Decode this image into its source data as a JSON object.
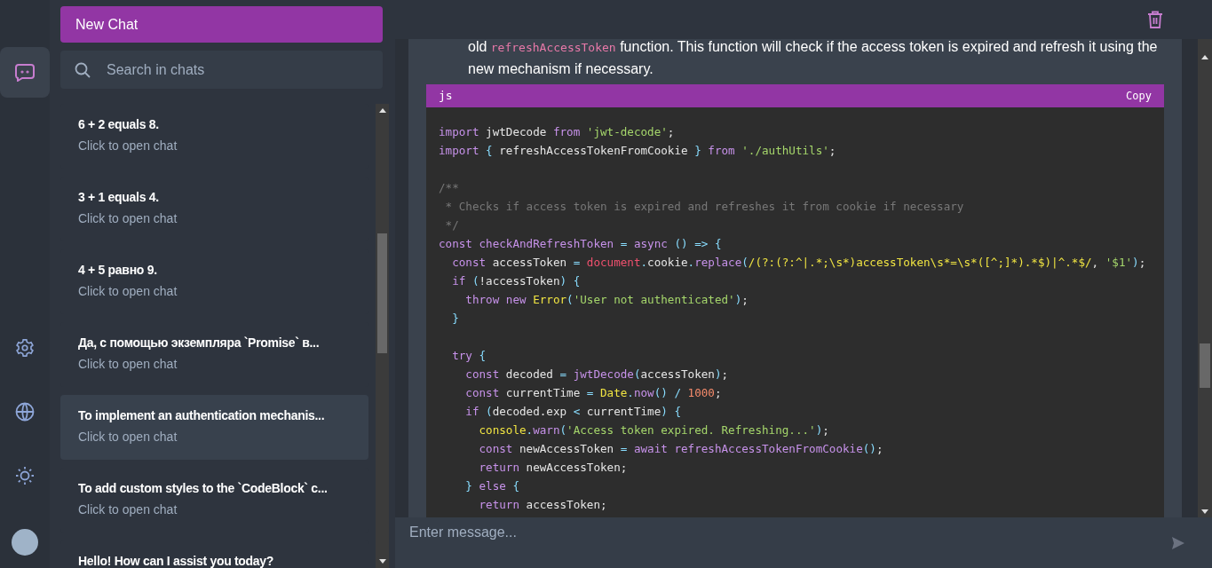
{
  "rail": {
    "items": [
      {
        "kind": "chat",
        "selected": true
      },
      {
        "kind": "settings",
        "selected": false
      },
      {
        "kind": "globe",
        "selected": false
      },
      {
        "kind": "theme",
        "selected": false
      }
    ]
  },
  "sidebar": {
    "new_chat": "New Chat",
    "search": {
      "placeholder": "Search in chats"
    },
    "chats": [
      {
        "title": "6 + 2 equals 8.",
        "subtitle": "Click to open chat",
        "selected": false
      },
      {
        "title": "3 + 1 equals 4.",
        "subtitle": "Click to open chat",
        "selected": false
      },
      {
        "title": "4 + 5 равно 9.",
        "subtitle": "Click to open chat",
        "selected": false
      },
      {
        "title": "Да, с помощью экземпляра `Promise` в...",
        "subtitle": "Click to open chat",
        "selected": false
      },
      {
        "title": "To implement an authentication mechanis...",
        "subtitle": "Click to open chat",
        "selected": true
      },
      {
        "title": "To add custom styles to the `CodeBlock` c...",
        "subtitle": "Click to open chat",
        "selected": false
      },
      {
        "title": "Hello! How can I assist you today?",
        "selected": false
      }
    ]
  },
  "message": {
    "paragraph": [
      {
        "kind": "text",
        "text": "old "
      },
      {
        "kind": "code",
        "text": "refreshAccessToken"
      },
      {
        "kind": "text",
        "text": " function. This function will check if the access token is expired and refresh it using the new mechanism if necessary."
      }
    ],
    "code_block": {
      "language": "js",
      "copy": "Copy",
      "lines": [
        [
          {
            "kind": "kw",
            "text": "import"
          },
          {
            "kind": "id",
            "text": " jwtDecode "
          },
          {
            "kind": "kw",
            "text": "from"
          },
          {
            "kind": "str",
            "text": " 'jwt-decode'"
          },
          {
            "kind": "id",
            "text": ";"
          }
        ],
        [
          {
            "kind": "kw",
            "text": "import"
          },
          {
            "kind": "punc",
            "text": " { "
          },
          {
            "kind": "id",
            "text": "refreshAccessTokenFromCookie"
          },
          {
            "kind": "punc",
            "text": " } "
          },
          {
            "kind": "kw",
            "text": "from"
          },
          {
            "kind": "str",
            "text": " './authUtils'"
          },
          {
            "kind": "id",
            "text": ";"
          }
        ],
        {
          "kind": "blank"
        },
        [
          {
            "kind": "com",
            "text": "/**"
          }
        ],
        [
          {
            "kind": "com",
            "text": " * Checks if access token is expired and refreshes it from cookie if necessary"
          }
        ],
        [
          {
            "kind": "com",
            "text": " */"
          }
        ],
        [
          {
            "kind": "kw",
            "text": "const"
          },
          {
            "kind": "fn",
            "text": " checkAndRefreshToken"
          },
          {
            "kind": "punc",
            "text": " = "
          },
          {
            "kind": "kw",
            "text": "async"
          },
          {
            "kind": "punc",
            "text": " () => {"
          }
        ],
        [
          {
            "kind": "kw",
            "text": "  const"
          },
          {
            "kind": "id",
            "text": " accessToken "
          },
          {
            "kind": "punc",
            "text": "= "
          },
          {
            "kind": "glob",
            "text": "document"
          },
          {
            "kind": "punc",
            "text": "."
          },
          {
            "kind": "id",
            "text": "cookie"
          },
          {
            "kind": "punc",
            "text": "."
          },
          {
            "kind": "fn",
            "text": "replace"
          },
          {
            "kind": "punc",
            "text": "("
          },
          {
            "kind": "obj",
            "text": "/(?:(?:^|.*;\\s*)accessToken\\s*=\\s*([^;]*).*$)|^.*$/"
          },
          {
            "kind": "id",
            "text": ", "
          },
          {
            "kind": "str",
            "text": "'$1'"
          },
          {
            "kind": "punc",
            "text": ")"
          },
          {
            "kind": "id",
            "text": ";"
          }
        ],
        [
          {
            "kind": "kw",
            "text": "  if"
          },
          {
            "kind": "punc",
            "text": " ("
          },
          {
            "kind": "id",
            "text": "!accessToken"
          },
          {
            "kind": "punc",
            "text": ") {"
          }
        ],
        [
          {
            "kind": "kw",
            "text": "    throw new"
          },
          {
            "kind": "obj",
            "text": " Error"
          },
          {
            "kind": "punc",
            "text": "("
          },
          {
            "kind": "str",
            "text": "'User not authenticated'"
          },
          {
            "kind": "punc",
            "text": ")"
          },
          {
            "kind": "id",
            "text": ";"
          }
        ],
        [
          {
            "kind": "punc",
            "text": "  }"
          }
        ],
        {
          "kind": "blank"
        },
        [
          {
            "kind": "kw",
            "text": "  try"
          },
          {
            "kind": "punc",
            "text": " {"
          }
        ],
        [
          {
            "kind": "kw",
            "text": "    const"
          },
          {
            "kind": "id",
            "text": " decoded "
          },
          {
            "kind": "punc",
            "text": "= "
          },
          {
            "kind": "fn",
            "text": "jwtDecode"
          },
          {
            "kind": "punc",
            "text": "("
          },
          {
            "kind": "id",
            "text": "accessToken"
          },
          {
            "kind": "punc",
            "text": ")"
          },
          {
            "kind": "id",
            "text": ";"
          }
        ],
        [
          {
            "kind": "kw",
            "text": "    const"
          },
          {
            "kind": "id",
            "text": " currentTime "
          },
          {
            "kind": "punc",
            "text": "= "
          },
          {
            "kind": "obj",
            "text": "Date"
          },
          {
            "kind": "punc",
            "text": "."
          },
          {
            "kind": "fn",
            "text": "now"
          },
          {
            "kind": "punc",
            "text": "() / "
          },
          {
            "kind": "num",
            "text": "1000"
          },
          {
            "kind": "id",
            "text": ";"
          }
        ],
        [
          {
            "kind": "kw",
            "text": "    if"
          },
          {
            "kind": "punc",
            "text": " ("
          },
          {
            "kind": "id",
            "text": "decoded.exp "
          },
          {
            "kind": "punc",
            "text": "< "
          },
          {
            "kind": "id",
            "text": "currentTime"
          },
          {
            "kind": "punc",
            "text": ") {"
          }
        ],
        [
          {
            "kind": "obj",
            "text": "      console"
          },
          {
            "kind": "punc",
            "text": "."
          },
          {
            "kind": "fn",
            "text": "warn"
          },
          {
            "kind": "punc",
            "text": "("
          },
          {
            "kind": "str",
            "text": "'Access token expired. Refreshing...'"
          },
          {
            "kind": "punc",
            "text": ")"
          },
          {
            "kind": "id",
            "text": ";"
          }
        ],
        [
          {
            "kind": "kw",
            "text": "      const"
          },
          {
            "kind": "id",
            "text": " newAccessToken "
          },
          {
            "kind": "punc",
            "text": "= "
          },
          {
            "kind": "kw",
            "text": "await"
          },
          {
            "kind": "fn",
            "text": " refreshAccessTokenFromCookie"
          },
          {
            "kind": "punc",
            "text": "()"
          },
          {
            "kind": "id",
            "text": ";"
          }
        ],
        [
          {
            "kind": "kw",
            "text": "      return"
          },
          {
            "kind": "id",
            "text": " newAccessToken;"
          }
        ],
        [
          {
            "kind": "punc",
            "text": "    } "
          },
          {
            "kind": "kw",
            "text": "else"
          },
          {
            "kind": "punc",
            "text": " {"
          }
        ],
        [
          {
            "kind": "kw",
            "text": "      return"
          },
          {
            "kind": "id",
            "text": " accessToken;"
          }
        ]
      ]
    }
  },
  "composer": {
    "placeholder": "Enter message..."
  }
}
